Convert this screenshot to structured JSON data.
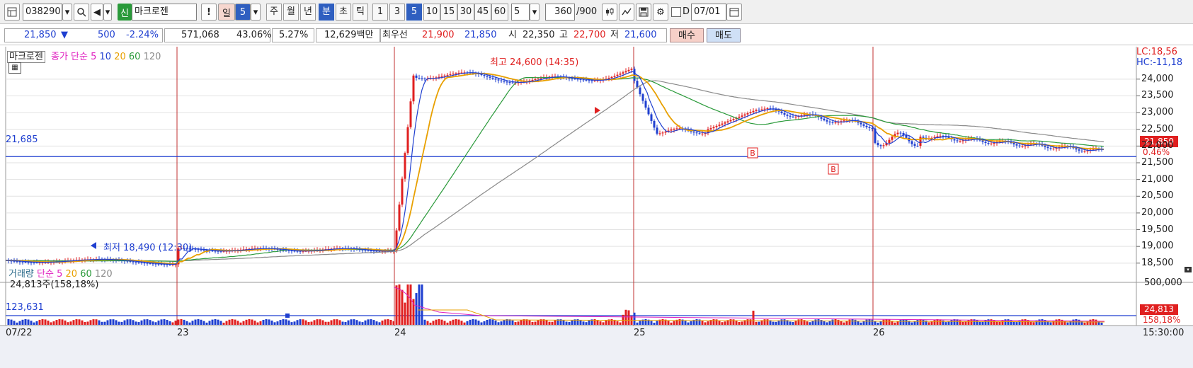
{
  "toolbar": {
    "code": "038290",
    "badge": "신",
    "name": "마크로젠",
    "alert": "!",
    "period_value": "5",
    "periods": [
      "주",
      "월",
      "년",
      "분",
      "초",
      "틱"
    ],
    "active_period": "분",
    "intervals": [
      "1",
      "3",
      "5",
      "10",
      "15",
      "30",
      "45",
      "60"
    ],
    "active_interval": "5",
    "count_select": "5",
    "range_value": "360",
    "range_total": "/900",
    "checkbox_label": "D",
    "date": "07/01"
  },
  "info": {
    "price": "21,850",
    "change": "500",
    "change_pct": "-2.24%",
    "volume": "571,068",
    "vol_ratio": "43.06%",
    "turnover": "5.27%",
    "amount": "12,629백만",
    "best_label": "최우선",
    "best_ask": "21,900",
    "best_bid": "21,850",
    "open_label": "시",
    "open": "22,350",
    "high_label": "고",
    "high": "22,700",
    "low_label": "저",
    "low": "21,600",
    "buy": "매수",
    "sell": "매도"
  },
  "price_panel": {
    "legend_name": "마크로젠",
    "legend_close": "종가 단순",
    "ma": [
      "5",
      "10",
      "20",
      "60",
      "120"
    ],
    "lc": "LC:18,56",
    "hc": "HC:-11,18",
    "current_price_tag": "21,850",
    "current_pct_tag": "0.46%",
    "left_level": "21,685",
    "high_annotation": "최고 24,600 (14:35)",
    "low_annotation": "최저 18,490 (12:30)",
    "y_ticks": [
      "24,000",
      "23,500",
      "23,000",
      "22,500",
      "22,000",
      "21,500",
      "21,000",
      "20,500",
      "20,000",
      "19,500",
      "19,000",
      "18,500"
    ]
  },
  "volume_panel": {
    "legend_name": "거래량",
    "legend_close": "단순",
    "ma": [
      "5",
      "20",
      "60",
      "120"
    ],
    "vol_text": "24,813주(158,18%)",
    "left_level": "123,631",
    "y_tick": "500,000",
    "current_tag": "24,813",
    "current_pct_tag": "158,18%"
  },
  "x_axis": {
    "labels": [
      "07/22",
      "23",
      "24",
      "25",
      "26"
    ],
    "time": "15:30:00"
  },
  "colors": {
    "up": "#e02020",
    "down": "#1f3fd0",
    "ma5": "#e020c0",
    "ma10": "#1f3fd0",
    "ma20": "#e8a000",
    "ma60": "#2a9a3a",
    "ma120": "#8a8a8a",
    "level": "#1f3fd0",
    "divider": "#c03030"
  }
}
